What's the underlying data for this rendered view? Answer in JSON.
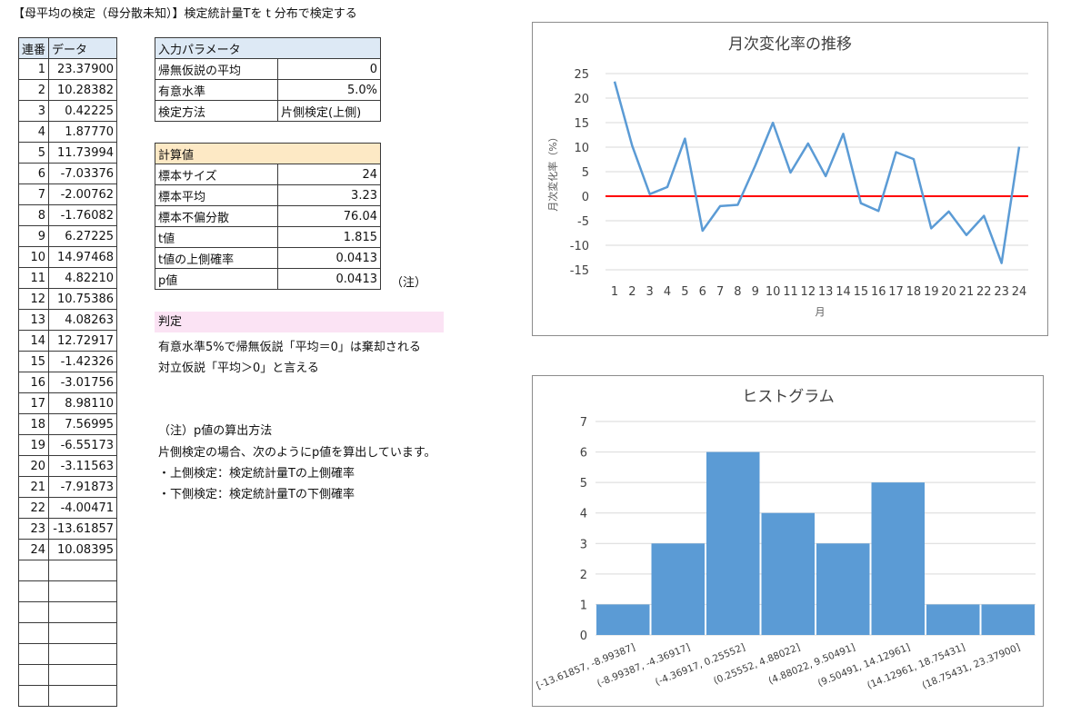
{
  "title": "【母平均の検定（母分散未知）】検定統計量Tを t 分布で検定する",
  "data_table": {
    "header": [
      "連番",
      "データ"
    ],
    "rows": [
      [
        "1",
        "23.37900"
      ],
      [
        "2",
        "10.28382"
      ],
      [
        "3",
        "0.42225"
      ],
      [
        "4",
        "1.87770"
      ],
      [
        "5",
        "11.73994"
      ],
      [
        "6",
        "-7.03376"
      ],
      [
        "7",
        "-2.00762"
      ],
      [
        "8",
        "-1.76082"
      ],
      [
        "9",
        "6.27225"
      ],
      [
        "10",
        "14.97468"
      ],
      [
        "11",
        "4.82210"
      ],
      [
        "12",
        "10.75386"
      ],
      [
        "13",
        "4.08263"
      ],
      [
        "14",
        "12.72917"
      ],
      [
        "15",
        "-1.42326"
      ],
      [
        "16",
        "-3.01756"
      ],
      [
        "17",
        "8.98110"
      ],
      [
        "18",
        "7.56995"
      ],
      [
        "19",
        "-6.55173"
      ],
      [
        "20",
        "-3.11563"
      ],
      [
        "21",
        "-7.91873"
      ],
      [
        "22",
        "-4.00471"
      ],
      [
        "23",
        "-13.61857"
      ],
      [
        "24",
        "10.08395"
      ],
      [
        "",
        ""
      ],
      [
        "",
        ""
      ],
      [
        "",
        ""
      ],
      [
        "",
        ""
      ],
      [
        "",
        ""
      ],
      [
        "",
        ""
      ],
      [
        "",
        ""
      ]
    ]
  },
  "params": {
    "header": "入力パラメータ",
    "rows": [
      {
        "label": "帰無仮説の平均",
        "value": "0"
      },
      {
        "label": "有意水準",
        "value": "5.0%"
      },
      {
        "label": "検定方法",
        "value": "片側検定(上側)"
      }
    ]
  },
  "calc": {
    "header": "計算値",
    "rows": [
      {
        "label": "標本サイズ",
        "value": "24"
      },
      {
        "label": "標本平均",
        "value": "3.23"
      },
      {
        "label": "標本不偏分散",
        "value": "76.04"
      },
      {
        "label": "t値",
        "value": "1.815"
      },
      {
        "label": "t値の上側確率",
        "value": "0.0413"
      },
      {
        "label": "p値",
        "value": "0.0413"
      }
    ],
    "note_mark": "（注）"
  },
  "judgement": {
    "header": "判定",
    "line1": "有意水準5%で帰無仮説「平均＝0」は棄却される",
    "line2": "対立仮説「平均＞0」と言える"
  },
  "note": {
    "title": "（注）p値の算出方法",
    "line1": "片側検定の場合、次のようにp値を算出しています。",
    "line2": "・上側検定：検定統計量Tの上側確率",
    "line3": "・下側検定：検定統計量Tの下側確率"
  },
  "chart_data": [
    {
      "type": "line",
      "title": "月次変化率の推移",
      "xlabel": "月",
      "ylabel": "月次変化率（%）",
      "x": [
        1,
        2,
        3,
        4,
        5,
        6,
        7,
        8,
        9,
        10,
        11,
        12,
        13,
        14,
        15,
        16,
        17,
        18,
        19,
        20,
        21,
        22,
        23,
        24
      ],
      "values": [
        23.379,
        10.28382,
        0.42225,
        1.8777,
        11.73994,
        -7.03376,
        -2.00762,
        -1.76082,
        6.27225,
        14.97468,
        4.8221,
        10.75386,
        4.08263,
        12.72917,
        -1.42326,
        -3.01756,
        8.9811,
        7.56995,
        -6.55173,
        -3.11563,
        -7.91873,
        -4.00471,
        -13.61857,
        10.08395
      ],
      "yticks": [
        25,
        20,
        15,
        10,
        5,
        0,
        -5,
        -10,
        -15
      ],
      "ylim": [
        -15,
        25
      ],
      "reference_line": 0,
      "line_color": "#5b9bd5",
      "reference_color": "#ff0000",
      "grid": true
    },
    {
      "type": "bar",
      "title": "ヒストグラム",
      "categories": [
        "[-13.61857, -8.99387]",
        "(-8.99387, -4.36917]",
        "(-4.36917, 0.25552]",
        "(0.25552, 4.88022]",
        "(4.88022, 9.50491]",
        "(9.50491, 14.12961]",
        "(14.12961, 18.75431]",
        "(18.75431, 23.37900]"
      ],
      "values": [
        1,
        3,
        6,
        4,
        3,
        5,
        1,
        1
      ],
      "yticks": [
        0,
        1,
        2,
        3,
        4,
        5,
        6,
        7
      ],
      "ylim": [
        0,
        7
      ],
      "bar_color": "#5b9bd5",
      "grid": true
    }
  ]
}
